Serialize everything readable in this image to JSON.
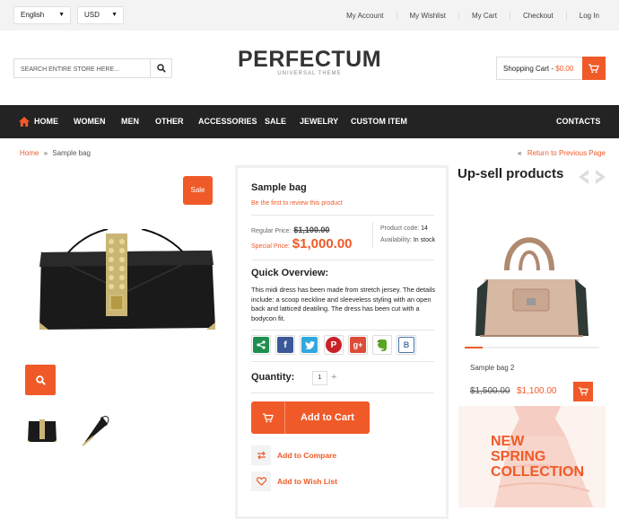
{
  "topbar": {
    "language": "English",
    "currency": "USD",
    "links": [
      "My Account",
      "My Wishlist",
      "My Cart",
      "Checkout",
      "Log In"
    ]
  },
  "header": {
    "search_placeholder": "SEARCH ENTIRE STORE HERE...",
    "logo_title": "PERFECTUM",
    "logo_subtitle": "UNIVERSAL THEME",
    "cart_label": "Shopping Cart - ",
    "cart_total": "$0.00"
  },
  "nav": {
    "items": [
      "HOME",
      "WOMEN",
      "MEN",
      "OTHER",
      "ACCESSORIES",
      "SALE",
      "JEWELRY",
      "CUSTOM ITEM"
    ],
    "right_item": "CONTACTS"
  },
  "breadcrumb": {
    "home": "Home",
    "separator": "»",
    "current": "Sample bag",
    "back_arrow": "«",
    "back_label": "Return to Previous Page"
  },
  "gallery": {
    "sale_badge": "Sale"
  },
  "product": {
    "name": "Sample bag",
    "review_link": "Be the first to review this product",
    "regular_label": "Regular Price:",
    "regular_price": "$1,100.00",
    "special_label": "Special Price:",
    "special_price": "$1,000.00",
    "code_label": "Product code:",
    "code_value": "14",
    "availability_label": "Availability:",
    "availability_value": "In stock",
    "overview_title": "Quick Overview:",
    "overview_text": "This midi dress has been made from stretch jersey. The details include: a scoop neckline and sleeveless styling with an open back and latticed deatiling. The dress has been cut with a bodycon fit.",
    "quantity_label": "Quantity:",
    "quantity_value": "1",
    "quantity_plus": "+",
    "add_to_cart": "Add to Cart",
    "add_to_compare": "Add to Compare",
    "add_to_wishlist": "Add to Wish List"
  },
  "social": [
    {
      "name": "share-icon",
      "glyph": "",
      "color": "#1e8f4e"
    },
    {
      "name": "facebook-icon",
      "glyph": "f",
      "color": "#3b5998"
    },
    {
      "name": "twitter-icon",
      "glyph": "",
      "color": "#2fa8e0"
    },
    {
      "name": "pinterest-icon",
      "glyph": "P",
      "color": "#cb2027"
    },
    {
      "name": "google-plus-icon",
      "glyph": "g+",
      "color": "#dd4b39"
    },
    {
      "name": "evernote-icon",
      "glyph": "",
      "color": "#5ba525"
    },
    {
      "name": "vk-icon",
      "glyph": "B",
      "color": "#4a76a8"
    }
  ],
  "upsell": {
    "title": "Up-sell products",
    "product_name": "Sample bag 2",
    "old_price": "$1,500.00",
    "new_price": "$1,100.00",
    "carousel_progress": 0.13
  },
  "banner": {
    "line1": "NEW",
    "line2": "SPRING",
    "line3": "COLLECTION"
  },
  "colors": {
    "accent": "#f05a28",
    "nav_bg": "#232323",
    "topbar_bg": "#f3f3f3"
  }
}
